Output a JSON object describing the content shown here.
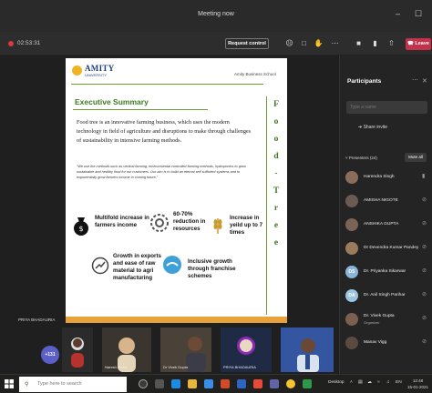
{
  "window": {
    "title": "Meeting now"
  },
  "toolbar": {
    "timer": "02:53:31",
    "request_control": "Request control",
    "leave": "Leave"
  },
  "slide": {
    "logo_text": "AMITY",
    "logo_sub": "UNIVERSITY",
    "school": "Amity Business School",
    "heading": "Executive Summary",
    "paragraph": "Food tree is an innovative farming business, which uses the modern technology in field of agriculture and disruptions to make through challenges of sustainability in intensive farming methods.",
    "quote": "\"We use the methods such as vertical farming, environmental controlled farming methods, hydroponics to grow sustainable and healthy food for our customers. Our aim is to build an eternal self sufficient systems and to exponentially grow farmers income in coming future.\"",
    "vertical_letters": [
      "F",
      "o",
      "o",
      "d",
      "-",
      "T",
      "r",
      "e",
      "e"
    ],
    "features": {
      "f1": "Multifold increase in farmers income",
      "f2": "60-70% reduction in resources",
      "f3": "Increase in yeild up to 7 times",
      "f4": "Growth in exports and ease of raw material to agri manufacturing",
      "f5": "Inclusive growth through franchise schemes"
    }
  },
  "stage": {
    "presenter_label": "PRIYA BHADAURIA"
  },
  "participants": {
    "title": "Participants",
    "search_placeholder": "Type a name",
    "share_invite": "Share invite",
    "presenters_label": "Presenters (24)",
    "mute_all": "Mute all",
    "list": [
      {
        "name": "Harendra Singh",
        "sub": "",
        "initials": ""
      },
      {
        "name": "AMISHA NIGOTE",
        "sub": "",
        "initials": ""
      },
      {
        "name": "ANSHIKA GUPTA",
        "sub": "",
        "initials": ""
      },
      {
        "name": "Dr Devendra Kumar Pandey",
        "sub": "",
        "initials": ""
      },
      {
        "name": "Dr. Priyanka Sikarwar",
        "sub": "",
        "initials": "DS"
      },
      {
        "name": "Dr. Anil Singh Parihar",
        "sub": "",
        "initials": "DA"
      },
      {
        "name": "Dr. Vivek Gupta",
        "sub": "Organizer",
        "initials": ""
      },
      {
        "name": "Manav Vigg",
        "sub": "",
        "initials": ""
      }
    ]
  },
  "strip": {
    "more_badge": "+131",
    "tiles": [
      "",
      "Naresh Kedia",
      "Dr Vivek Gupta",
      "PRIYA BHADAURIA",
      ""
    ]
  },
  "taskbar": {
    "search_placeholder": "Type here to search",
    "tray_desktop": "Desktop",
    "time": "12:48",
    "date": "15-01-2021"
  },
  "colors": {
    "leave": "#c4314b",
    "accent_green": "#3d7a1e",
    "bottom_bar": "#e8a23a",
    "teams_purple": "#5b5fc7"
  }
}
